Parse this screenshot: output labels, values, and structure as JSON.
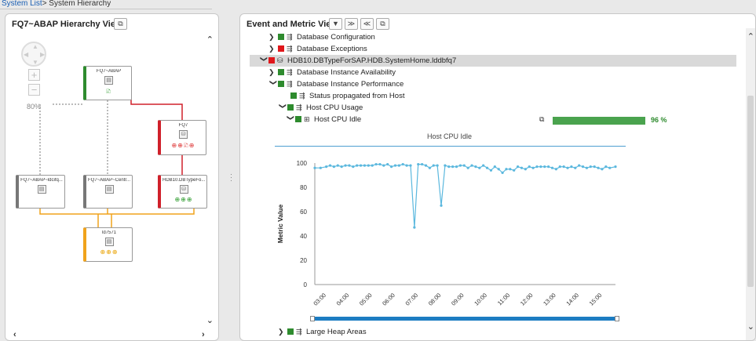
{
  "breadcrumb": {
    "link": "System List",
    "separator": ">",
    "current": " System Hierarchy"
  },
  "left_panel": {
    "title": "FQ7~ABAP Hierarchy View",
    "zoom_level": "80%",
    "zoom_in": "+",
    "zoom_out": "−",
    "nodes": [
      {
        "title": "FQ7~ABAP",
        "icon": "▤",
        "badges": "🗈"
      },
      {
        "title": "FQ7",
        "icon": "⛁",
        "badges": "⊕⊕🗈⊕"
      },
      {
        "title": "FQ7~ABAP~ldcifq...",
        "icon": "▤",
        "badges": ""
      },
      {
        "title": "FQ7~ABAP~Centr...",
        "icon": "▤",
        "badges": ""
      },
      {
        "title": "HDB10.DBTypeFo...",
        "icon": "⛁",
        "badges": "⊕⊕⊕"
      },
      {
        "title": "ld7571",
        "icon": "▤",
        "badges": "⊕⊕⊕"
      }
    ]
  },
  "right_panel": {
    "title": "Event and Metric View",
    "toolbar": {
      "filter": "▼",
      "collapse_all": "≫",
      "expand_all": "≪",
      "detach": "⧉"
    },
    "rows": [
      {
        "caret": "❯",
        "label": "Database Configuration",
        "status": "green"
      },
      {
        "caret": "❯",
        "label": "Database Exceptions",
        "status": "red"
      },
      {
        "caret": "❯",
        "label": "HDB10.DBTypeForSAP.HDB.SystemHome.lddbfq7",
        "status": "red"
      },
      {
        "caret": "❯",
        "label": "Database Instance Availability",
        "status": "green"
      },
      {
        "caret": "❯",
        "label": "Database Instance Performance",
        "status": "green"
      },
      {
        "caret": "",
        "label": "Status propagated from Host",
        "status": "green"
      },
      {
        "caret": "❯",
        "label": "Host CPU Usage",
        "status": "green"
      },
      {
        "caret": "❯",
        "label": "Host CPU Idle",
        "status": "green"
      },
      {
        "caret": "❯",
        "label": "Large Heap Areas",
        "status": "green"
      }
    ],
    "metric_value": "96 %",
    "metric_fraction": 0.96
  },
  "chart_data": {
    "type": "line",
    "title": "Host CPU Idle",
    "ylabel": "Metric Value",
    "xlabel": "",
    "ylim": [
      0,
      100
    ],
    "yticks": [
      0,
      20,
      40,
      60,
      80,
      100
    ],
    "xticks": [
      "03:00",
      "04:00",
      "05:00",
      "06:00",
      "07:00",
      "08:00",
      "09:00",
      "10:00",
      "11:00",
      "12:00",
      "13:00",
      "14:00",
      "15:00"
    ],
    "x_range": [
      "02:30",
      "15:35"
    ],
    "series": [
      {
        "color": "#5bb8de",
        "x": [
          "02:30",
          "02:45",
          "03:00",
          "03:10",
          "03:20",
          "03:30",
          "03:40",
          "03:50",
          "04:00",
          "04:10",
          "04:20",
          "04:30",
          "04:40",
          "04:50",
          "05:00",
          "05:10",
          "05:20",
          "05:30",
          "05:40",
          "05:50",
          "06:00",
          "06:10",
          "06:20",
          "06:30",
          "06:40",
          "06:50",
          "07:00",
          "07:10",
          "07:20",
          "07:30",
          "07:40",
          "07:50",
          "08:00",
          "08:10",
          "08:20",
          "08:30",
          "08:40",
          "08:50",
          "09:00",
          "09:10",
          "09:20",
          "09:30",
          "09:40",
          "09:50",
          "10:00",
          "10:10",
          "10:20",
          "10:30",
          "10:40",
          "10:50",
          "11:00",
          "11:10",
          "11:20",
          "11:30",
          "11:40",
          "11:50",
          "12:00",
          "12:10",
          "12:20",
          "12:30",
          "12:40",
          "12:50",
          "13:00",
          "13:10",
          "13:20",
          "13:30",
          "13:40",
          "13:50",
          "14:00",
          "14:10",
          "14:20",
          "14:30",
          "14:40",
          "14:50",
          "15:00",
          "15:10",
          "15:20",
          "15:35"
        ],
        "y": [
          96,
          96,
          97,
          98,
          97,
          98,
          97,
          98,
          98,
          97,
          98,
          98,
          98,
          98,
          98,
          99,
          99,
          98,
          99,
          97,
          98,
          98,
          99,
          98,
          98,
          47,
          99,
          99,
          98,
          96,
          98,
          98,
          65,
          98,
          97,
          97,
          97,
          98,
          98,
          96,
          98,
          97,
          96,
          98,
          96,
          94,
          97,
          95,
          92,
          95,
          95,
          94,
          97,
          96,
          95,
          97,
          96,
          97,
          97,
          97,
          97,
          96,
          95,
          97,
          97,
          96,
          97,
          96,
          98,
          97,
          96,
          97,
          97,
          96,
          95,
          97,
          96,
          97
        ]
      }
    ]
  }
}
